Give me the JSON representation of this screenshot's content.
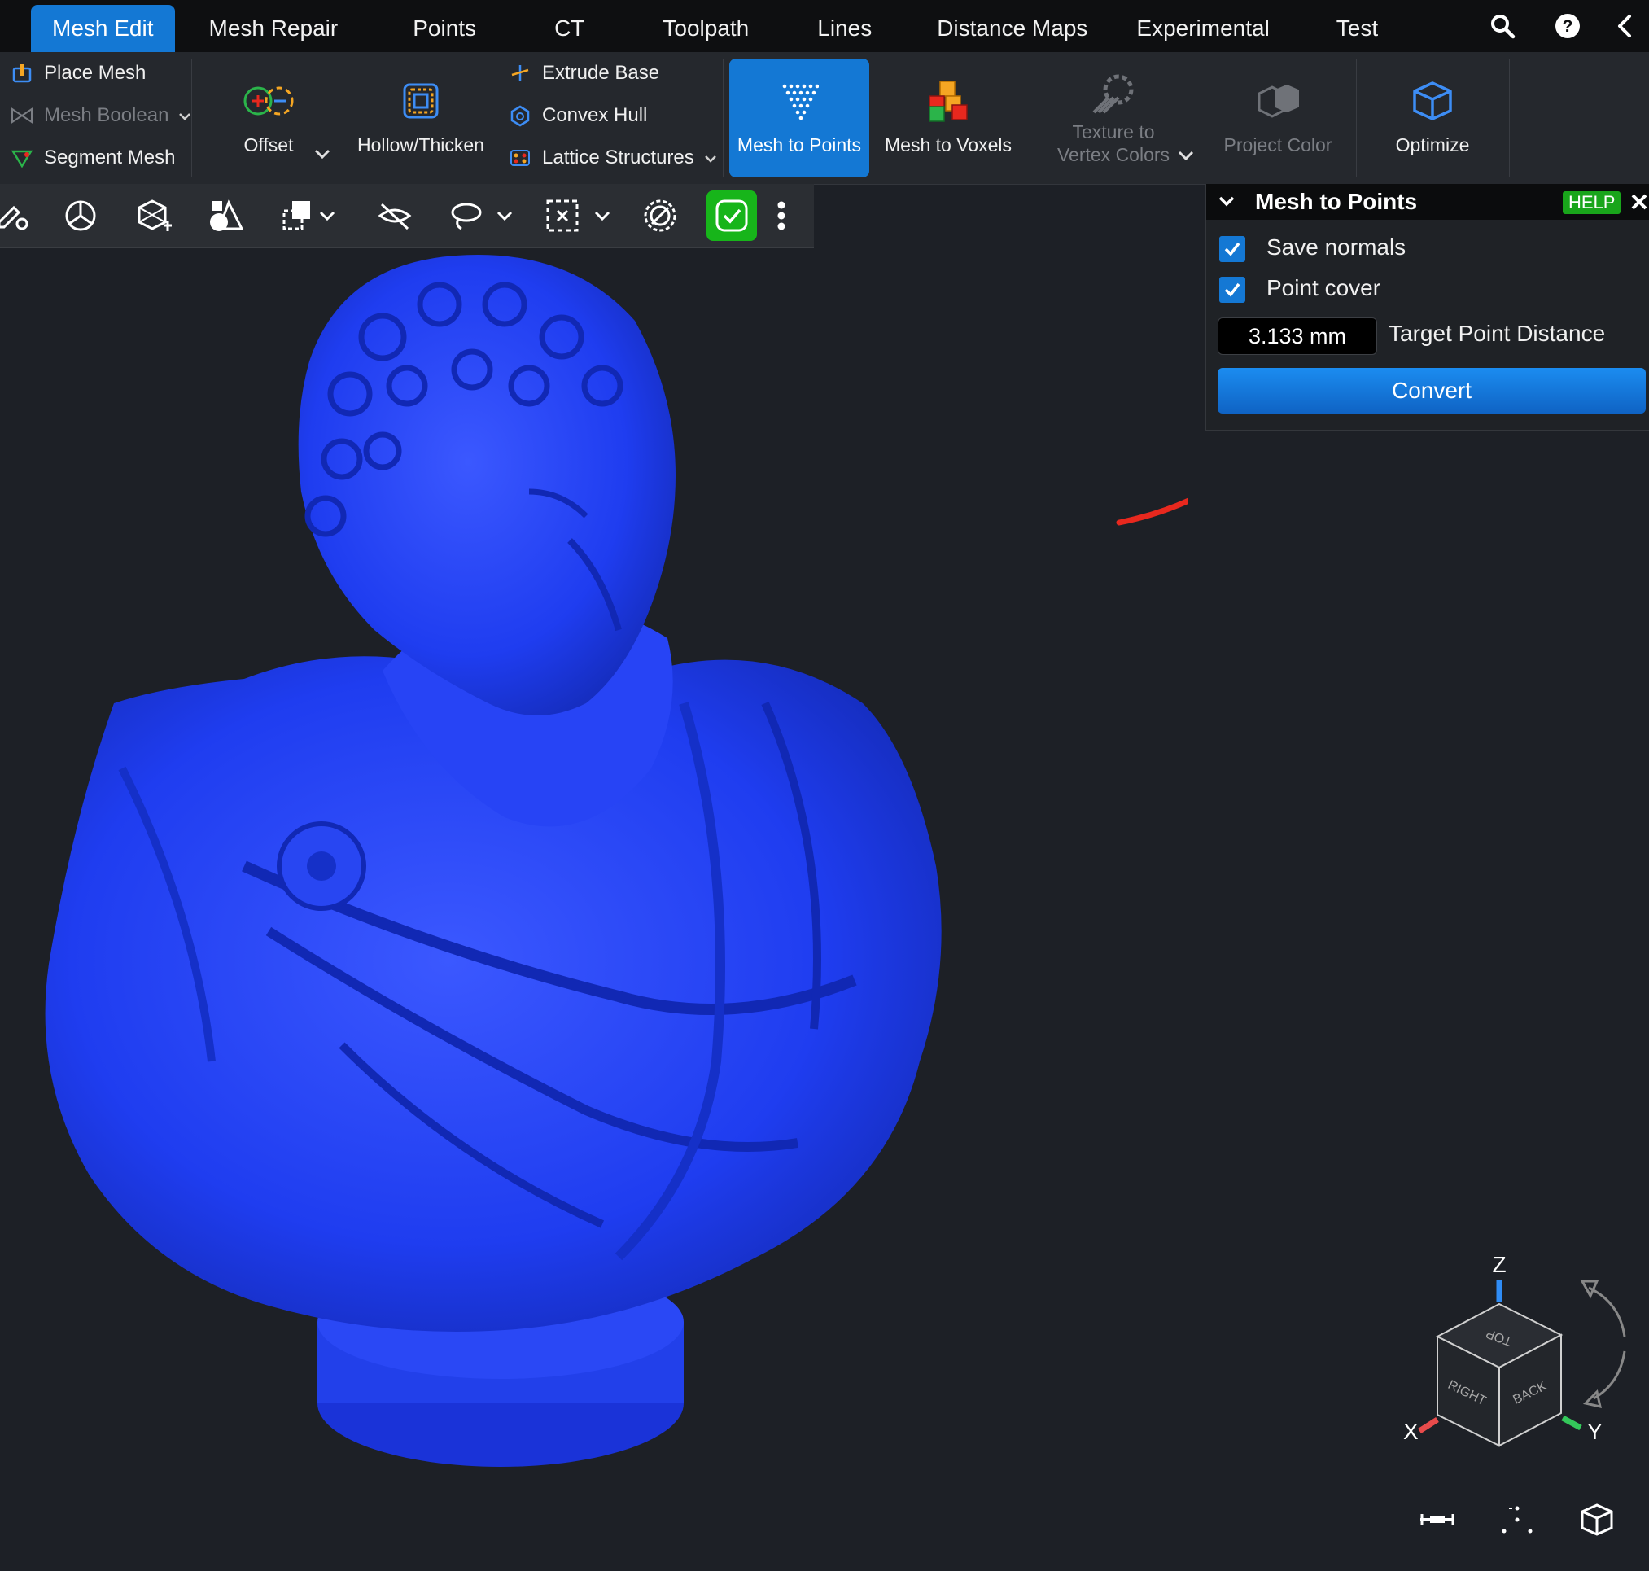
{
  "tabs": [
    "Mesh Edit",
    "Mesh Repair",
    "Points",
    "CT",
    "Toolpath",
    "Lines",
    "Distance Maps",
    "Experimental",
    "Test"
  ],
  "active_tab": "Mesh Edit",
  "tab_icons": [
    "search-icon",
    "help-icon",
    "collapse-left-icon"
  ],
  "ribbon": {
    "col1": {
      "place_mesh": "Place Mesh",
      "mesh_boolean": "Mesh Boolean",
      "segment_mesh": "Segment Mesh"
    },
    "offset": "Offset",
    "hollow_thicken": "Hollow/Thicken",
    "col3": {
      "extrude_base": "Extrude Base",
      "convex_hull": "Convex Hull",
      "lattice_structures": "Lattice Structures"
    },
    "mesh_to_points": "Mesh to Points",
    "mesh_to_voxels": "Mesh to Voxels",
    "texture_to_vertex_colors": "Texture to\nVertex Colors",
    "texture_line1": "Texture to",
    "texture_line2": "Vertex Colors",
    "project_color": "Project Color",
    "optimize": "Optimize"
  },
  "viewport_tools": [
    "edit-settings-icon",
    "mercedes-select-icon",
    "transform-icon",
    "primitives-icon",
    "clone-icon",
    "hide-icon",
    "lasso-icon",
    "box-select-icon",
    "deselect-icon",
    "confirm-icon",
    "more-icon"
  ],
  "panel": {
    "title": "Mesh to Points",
    "help": "HELP",
    "save_normals": {
      "label": "Save normals",
      "checked": true
    },
    "point_cover": {
      "label": "Point cover",
      "checked": true
    },
    "target_distance": {
      "value": "3.133 mm",
      "label": "Target Point Distance"
    },
    "convert": "Convert"
  },
  "axes": {
    "z": "Z",
    "x": "X",
    "y": "Y",
    "top": "TOP",
    "right": "RIGHT",
    "back": "BACK"
  },
  "colors": {
    "accent": "#1478d4",
    "model": "#1f3df0",
    "green": "#17b51a",
    "annotation_arrow": "#e8281e"
  }
}
